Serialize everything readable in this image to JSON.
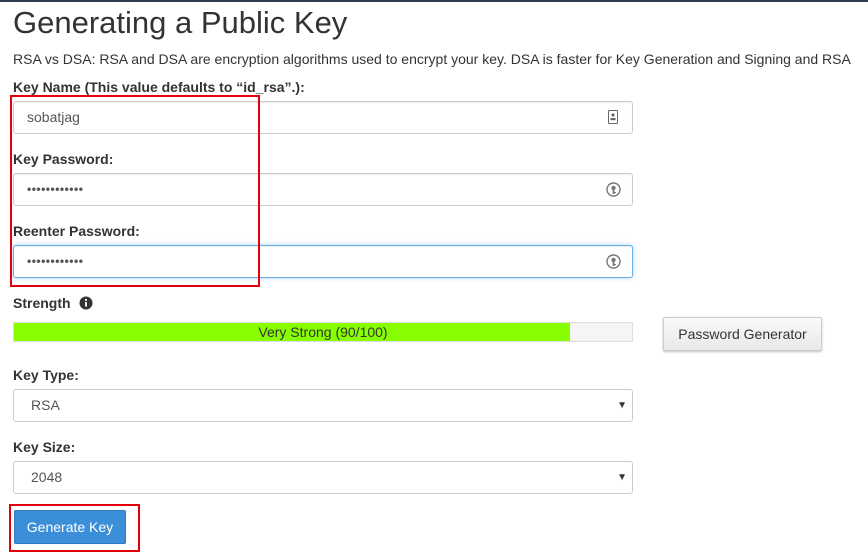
{
  "page": {
    "title": "Generating a Public Key",
    "intro": "RSA vs DSA: RSA and DSA are encryption algorithms used to encrypt your key. DSA is faster for Key Generation and Signing and RSA"
  },
  "form": {
    "key_name": {
      "label": "Key Name (This value defaults to “id_rsa”.):",
      "value": "sobatjag",
      "icon": "contact-card-icon"
    },
    "key_password": {
      "label": "Key Password:",
      "value": "••••••••••••",
      "icon": "key-reveal-icon"
    },
    "reenter_password": {
      "label": "Reenter Password:",
      "value": "••••••••••••",
      "icon": "key-reveal-icon"
    },
    "strength": {
      "label": "Strength",
      "info_icon": "info-circle-icon",
      "meter_text": "Very Strong (90/100)",
      "score": 90,
      "max": 100,
      "fill_color": "#88ff00"
    },
    "password_generator_label": "Password Generator",
    "key_type": {
      "label": "Key Type:",
      "selected": "RSA"
    },
    "key_size": {
      "label": "Key Size:",
      "selected": "2048"
    },
    "generate_label": "Generate Key"
  },
  "colors": {
    "primary_button": "#3b8ed8",
    "highlight_box": "#e2000d",
    "focus_border": "#66afe9"
  }
}
